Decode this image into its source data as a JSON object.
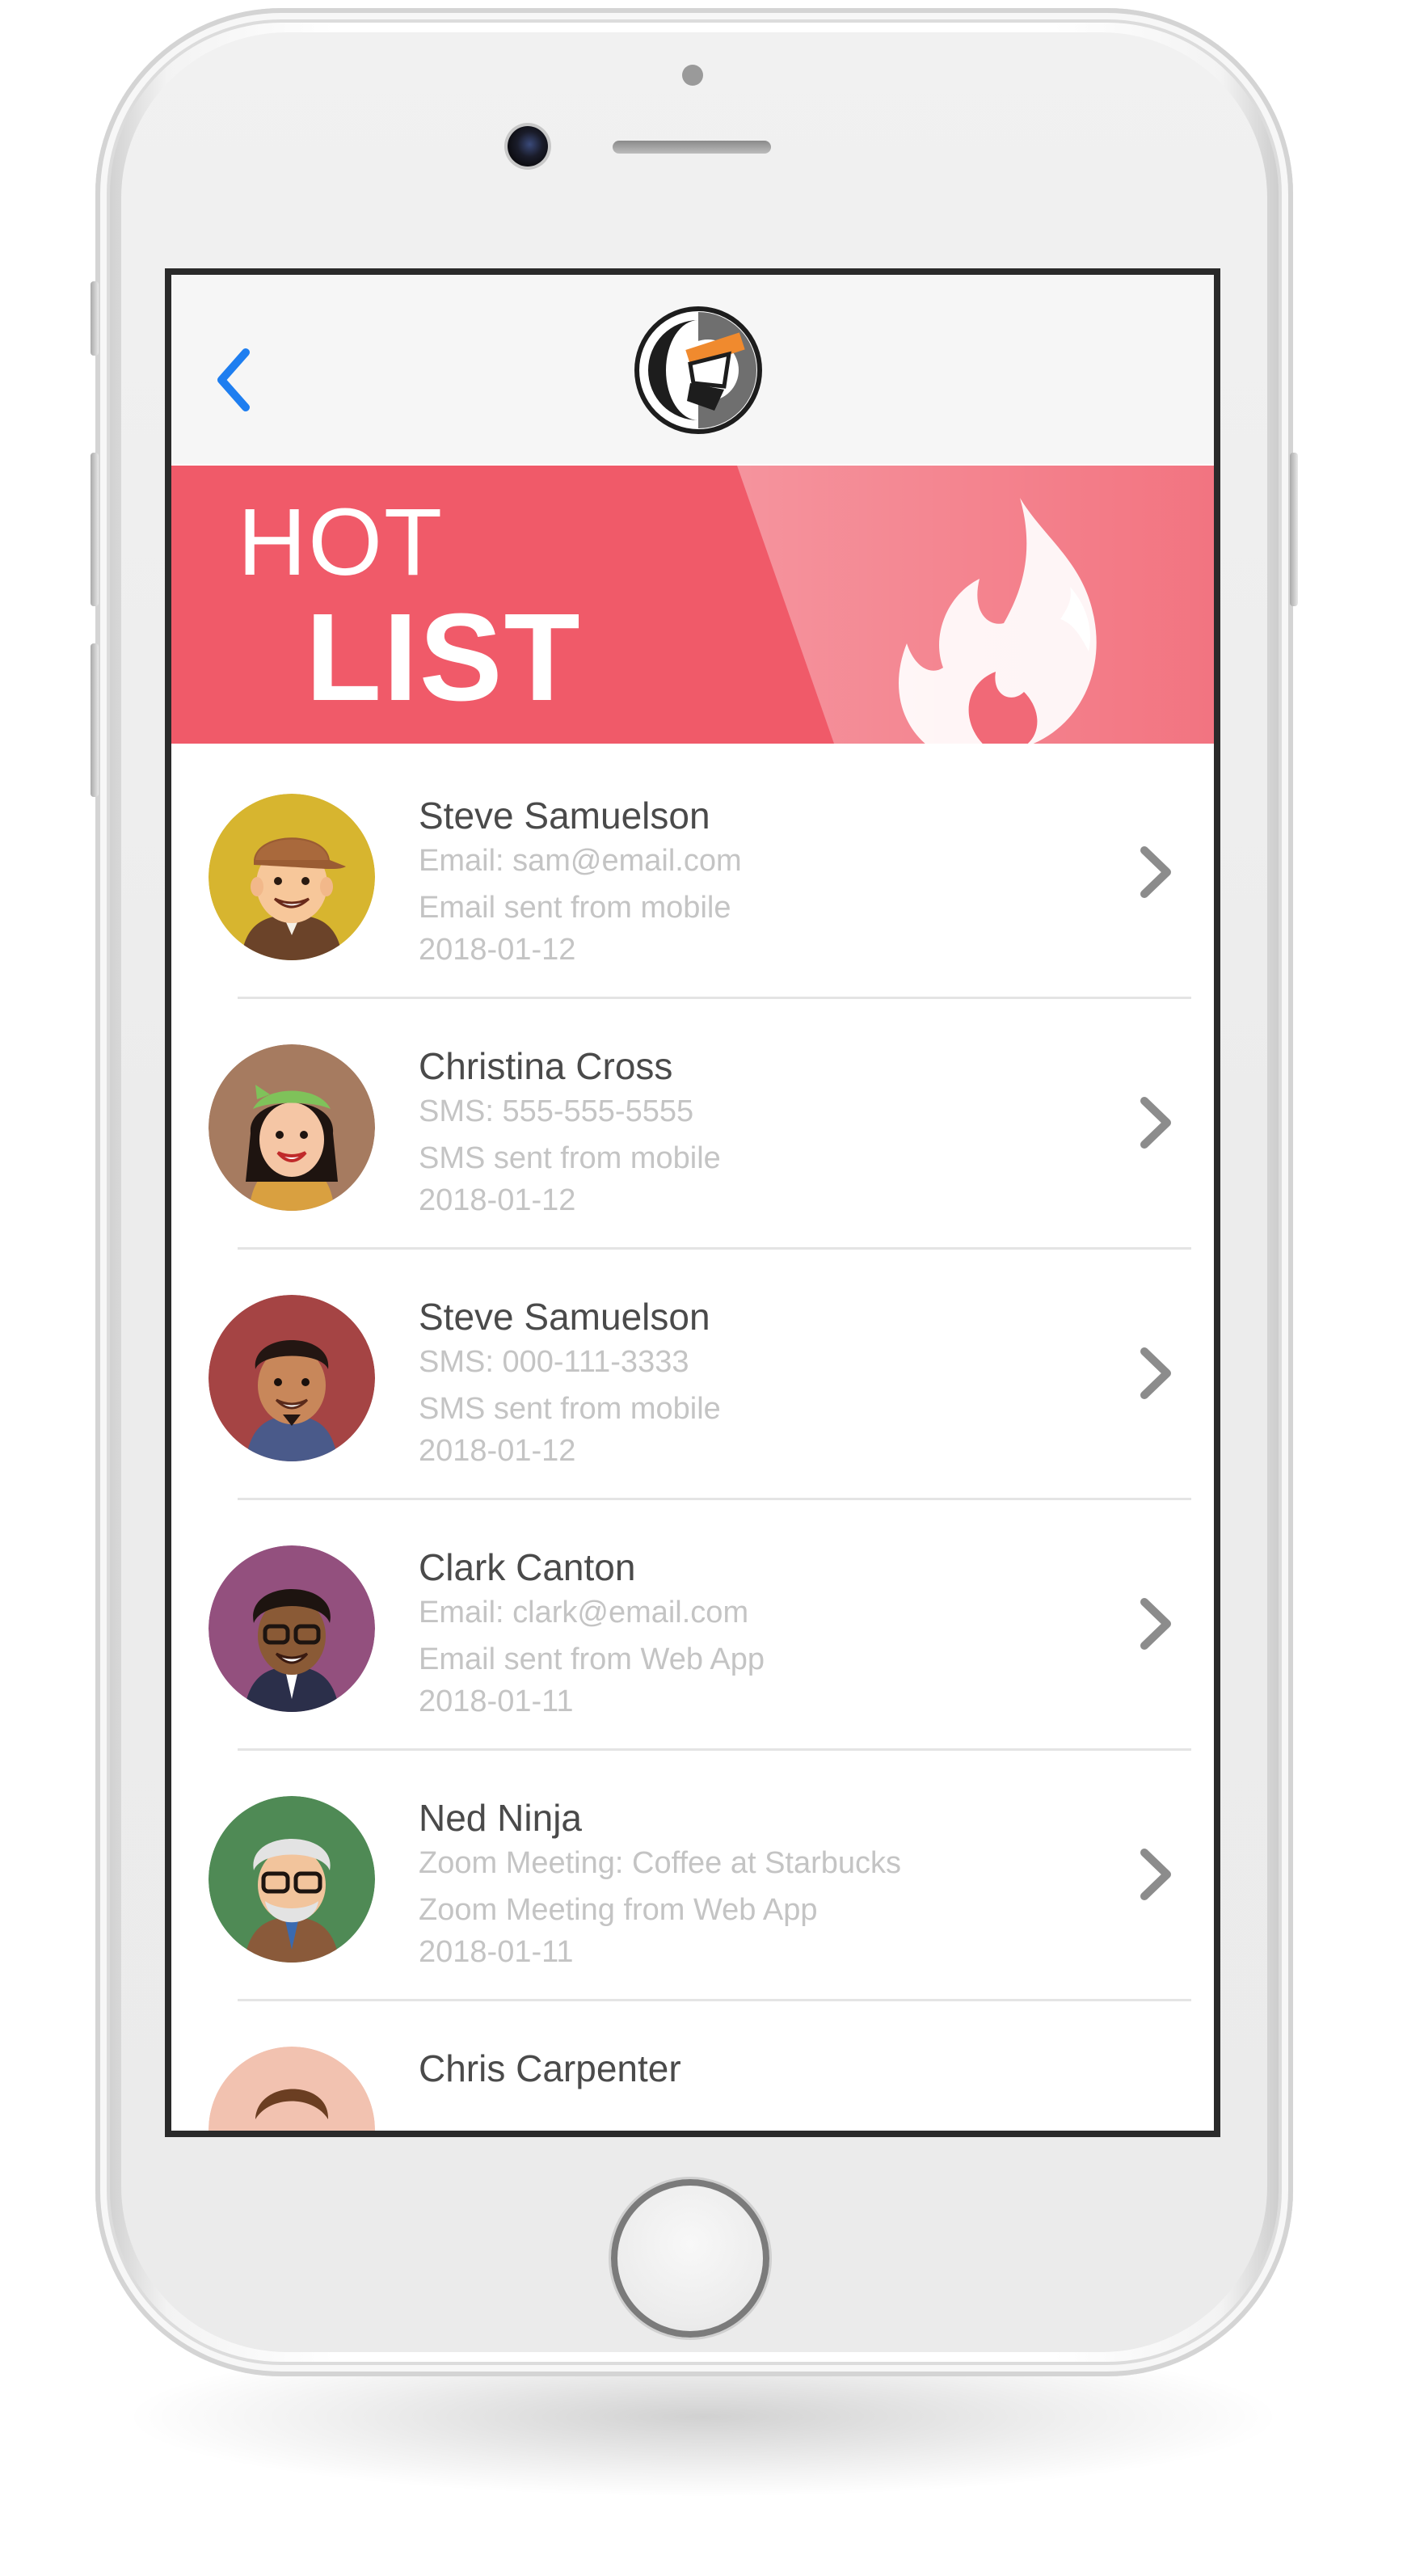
{
  "banner": {
    "title_line1": "HOT",
    "title_line2": "LIST"
  },
  "colors": {
    "banner": "#f05a69",
    "back_chevron": "#1e7ef0",
    "name_text": "#4a4a4a",
    "detail_text": "#c4c4c4"
  },
  "contacts": [
    {
      "name": "Steve Samuelson",
      "contact": "Email: sam@email.com",
      "activity": "Email sent from mobile",
      "date": "2018-01-12",
      "avatar_bg": "#d7b52f"
    },
    {
      "name": "Christina Cross",
      "contact": "SMS: 555-555-5555",
      "activity": "SMS sent from mobile",
      "date": "2018-01-12",
      "avatar_bg": "#a67b60"
    },
    {
      "name": "Steve Samuelson",
      "contact": "SMS: 000-111-3333",
      "activity": "SMS sent from mobile",
      "date": "2018-01-12",
      "avatar_bg": "#a54444"
    },
    {
      "name": "Clark Canton",
      "contact": "Email: clark@email.com",
      "activity": "Email sent from Web App",
      "date": "2018-01-11",
      "avatar_bg": "#93507e"
    },
    {
      "name": "Ned Ninja",
      "contact": "Zoom Meeting: Coffee at Starbucks",
      "activity": "Zoom Meeting from Web App",
      "date": "2018-01-11",
      "avatar_bg": "#4f8a55"
    },
    {
      "name": "Chris Carpenter",
      "contact": "",
      "activity": "",
      "date": "",
      "avatar_bg": "#f2c2b0"
    }
  ],
  "icons": {
    "back": "chevron-left-icon",
    "row_action": "chevron-right-icon",
    "banner_art": "flame-icon",
    "logo": "app-logo"
  }
}
